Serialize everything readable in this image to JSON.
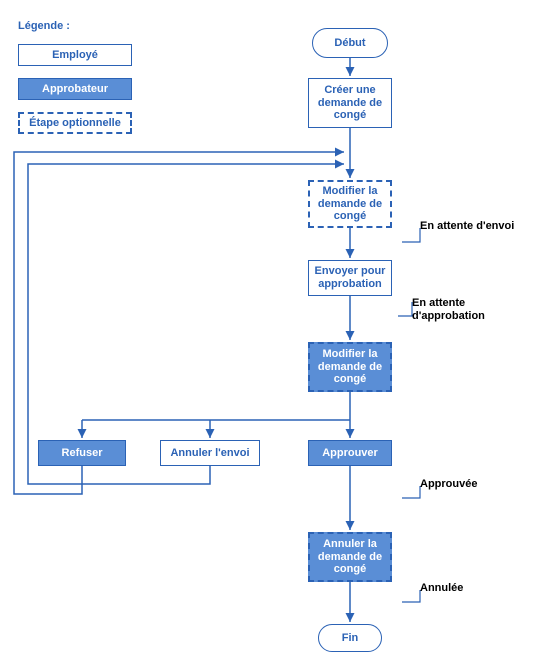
{
  "colors": {
    "line": "#2b62b5",
    "approver_fill": "#5a8ed6",
    "bg": "#ffffff"
  },
  "legend": {
    "title": "Légende :",
    "employee": "Employé",
    "approver": "Approbateur",
    "optional": "Étape optionnelle"
  },
  "nodes": {
    "start": "Début",
    "create": "Créer une demande de congé",
    "modify_emp": "Modifier la demande de congé",
    "send": "Envoyer pour approbation",
    "modify_appr": "Modifier la demande de congé",
    "refuse": "Refuser",
    "cancel_send": "Annuler l'envoi",
    "approve": "Approuver",
    "cancel_request": "Annuler la demande de congé",
    "end": "Fin"
  },
  "statuses": {
    "wait_send": "En attente d'envoi",
    "wait_approve": "En attente d'approbation",
    "approved": "Approuvée",
    "cancelled": "Annulée"
  },
  "chart_data": {
    "type": "flowchart",
    "legend": {
      "title": "Légende :",
      "items": [
        {
          "id": "employee",
          "label": "Employé",
          "style": "solid_outline_white_fill"
        },
        {
          "id": "approver",
          "label": "Approbateur",
          "style": "solid_outline_blue_fill"
        },
        {
          "id": "optional",
          "label": "Étape optionnelle",
          "style": "dashed_outline"
        }
      ]
    },
    "nodes": [
      {
        "id": "start",
        "label": "Début",
        "shape": "terminator",
        "role": "employee",
        "optional": false
      },
      {
        "id": "create",
        "label": "Créer une demande de congé",
        "shape": "process",
        "role": "employee",
        "optional": false
      },
      {
        "id": "modify_emp",
        "label": "Modifier la demande de congé",
        "shape": "process",
        "role": "employee",
        "optional": true
      },
      {
        "id": "send",
        "label": "Envoyer pour approbation",
        "shape": "process",
        "role": "employee",
        "optional": false
      },
      {
        "id": "modify_appr",
        "label": "Modifier la demande de congé",
        "shape": "process",
        "role": "approver",
        "optional": true
      },
      {
        "id": "refuse",
        "label": "Refuser",
        "shape": "process",
        "role": "approver",
        "optional": false
      },
      {
        "id": "cancel_send",
        "label": "Annuler l'envoi",
        "shape": "process",
        "role": "employee",
        "optional": false
      },
      {
        "id": "approve",
        "label": "Approuver",
        "shape": "process",
        "role": "approver",
        "optional": false
      },
      {
        "id": "cancel_request",
        "label": "Annuler la demande de congé",
        "shape": "process",
        "role": "approver",
        "optional": true
      },
      {
        "id": "end",
        "label": "Fin",
        "shape": "terminator",
        "role": "employee",
        "optional": false
      }
    ],
    "statuses": [
      {
        "after": "modify_emp",
        "label": "En attente d'envoi"
      },
      {
        "after": "send",
        "label": "En attente d'approbation"
      },
      {
        "after": "approve",
        "label": "Approuvée"
      },
      {
        "after": "cancel_request",
        "label": "Annulée"
      }
    ],
    "edges": [
      {
        "from": "start",
        "to": "create"
      },
      {
        "from": "create",
        "to": "modify_emp"
      },
      {
        "from": "modify_emp",
        "to": "send"
      },
      {
        "from": "send",
        "to": "modify_appr"
      },
      {
        "from": "modify_appr",
        "to": "refuse"
      },
      {
        "from": "modify_appr",
        "to": "cancel_send"
      },
      {
        "from": "modify_appr",
        "to": "approve"
      },
      {
        "from": "approve",
        "to": "cancel_request"
      },
      {
        "from": "cancel_request",
        "to": "end"
      },
      {
        "from": "refuse",
        "to": "modify_emp",
        "kind": "loop_back"
      },
      {
        "from": "cancel_send",
        "to": "modify_emp",
        "kind": "loop_back"
      }
    ]
  }
}
